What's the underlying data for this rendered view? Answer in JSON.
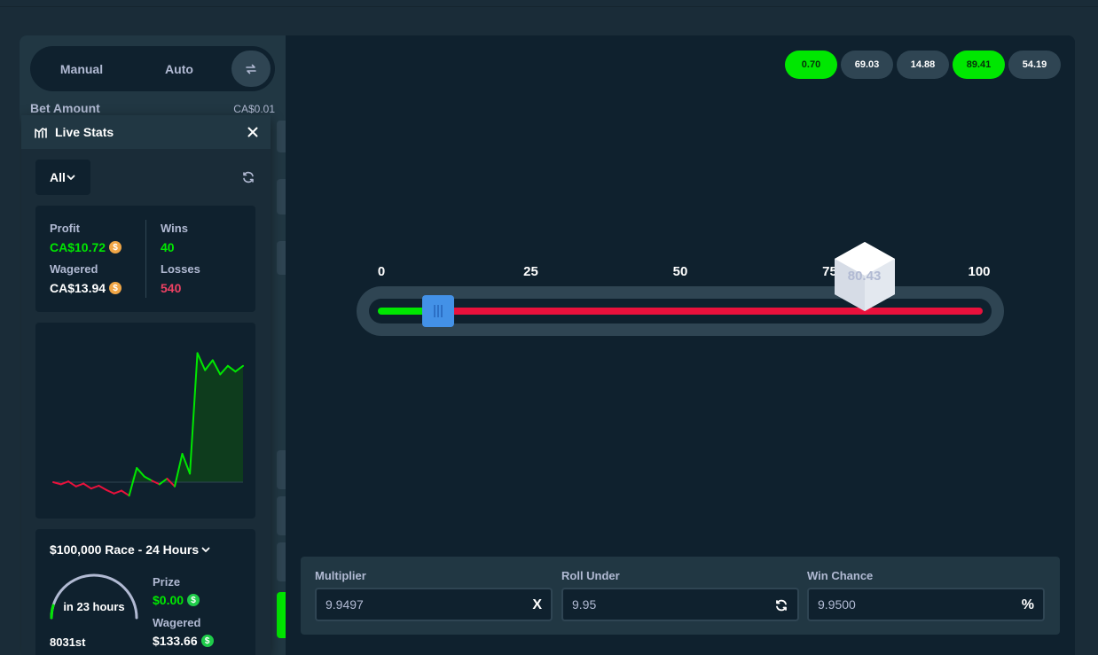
{
  "sidebar": {
    "mode_manual": "Manual",
    "mode_auto": "Auto",
    "bet_amount_label": "Bet Amount",
    "bet_amount_value": "CA$0.01"
  },
  "live_stats": {
    "title": "Live Stats",
    "filter": "All",
    "profit_label": "Profit",
    "profit_value": "CA$10.72",
    "wagered_label": "Wagered",
    "wagered_value": "CA$13.94",
    "wins_label": "Wins",
    "wins_value": "40",
    "losses_label": "Losses",
    "losses_value": "540",
    "race": {
      "title": "$100,000 Race - 24 Hours",
      "time_left": "in 23 hours",
      "rank": "8031st",
      "prize_label": "Prize",
      "prize_value": "$0.00",
      "wagered_label": "Wagered",
      "wagered_value": "$133.66"
    }
  },
  "chart_data": {
    "type": "area",
    "title": "",
    "xlabel": "",
    "ylabel": "",
    "x": [
      0,
      1,
      2,
      3,
      4,
      5,
      6,
      7,
      8,
      9,
      10,
      11,
      12,
      13,
      14,
      15,
      16,
      17,
      18,
      19,
      20,
      21,
      22,
      23,
      24,
      25
    ],
    "y": [
      0,
      -0.3,
      0.1,
      -0.6,
      -0.2,
      -0.9,
      -0.5,
      -1.1,
      -1.6,
      -1.2,
      -1.9,
      2.0,
      0.8,
      0.2,
      -0.3,
      0.5,
      -0.6,
      4.0,
      1.2,
      18.2,
      15.8,
      17.2,
      15.2,
      16.4,
      15.6,
      16.4
    ],
    "ylim": [
      -2.5,
      20
    ],
    "baseline": 0,
    "colors": {
      "positive": "#00e701",
      "negative": "#e9113c",
      "positive_fill": "#0e3c1d"
    }
  },
  "game": {
    "history": [
      {
        "value": "0.70",
        "win": true
      },
      {
        "value": "69.03",
        "win": false
      },
      {
        "value": "14.88",
        "win": false
      },
      {
        "value": "89.41",
        "win": true
      },
      {
        "value": "54.19",
        "win": false
      }
    ],
    "scale_labels": [
      "0",
      "25",
      "50",
      "75",
      "100"
    ],
    "slider_value": 9.95,
    "last_roll": "80.43",
    "last_roll_value": 80.43,
    "multiplier_label": "Multiplier",
    "multiplier_value": "9.9497",
    "multiplier_suffix": "X",
    "roll_under_label": "Roll Under",
    "roll_under_value": "9.95",
    "win_chance_label": "Win Chance",
    "win_chance_value": "9.9500",
    "win_chance_suffix": "%"
  },
  "colors": {
    "accent_green": "#00e701",
    "loss_red": "#e9113c",
    "slider_blue": "#4391e7",
    "panel": "#213743",
    "background": "#0f212e"
  },
  "icons": {
    "live_stats": "bar-chart-icon",
    "close": "close-icon",
    "refresh": "refresh-icon",
    "swap": "swap-arrows-icon",
    "dropdown": "chevron-down-icon",
    "coin": "coin-icon"
  }
}
